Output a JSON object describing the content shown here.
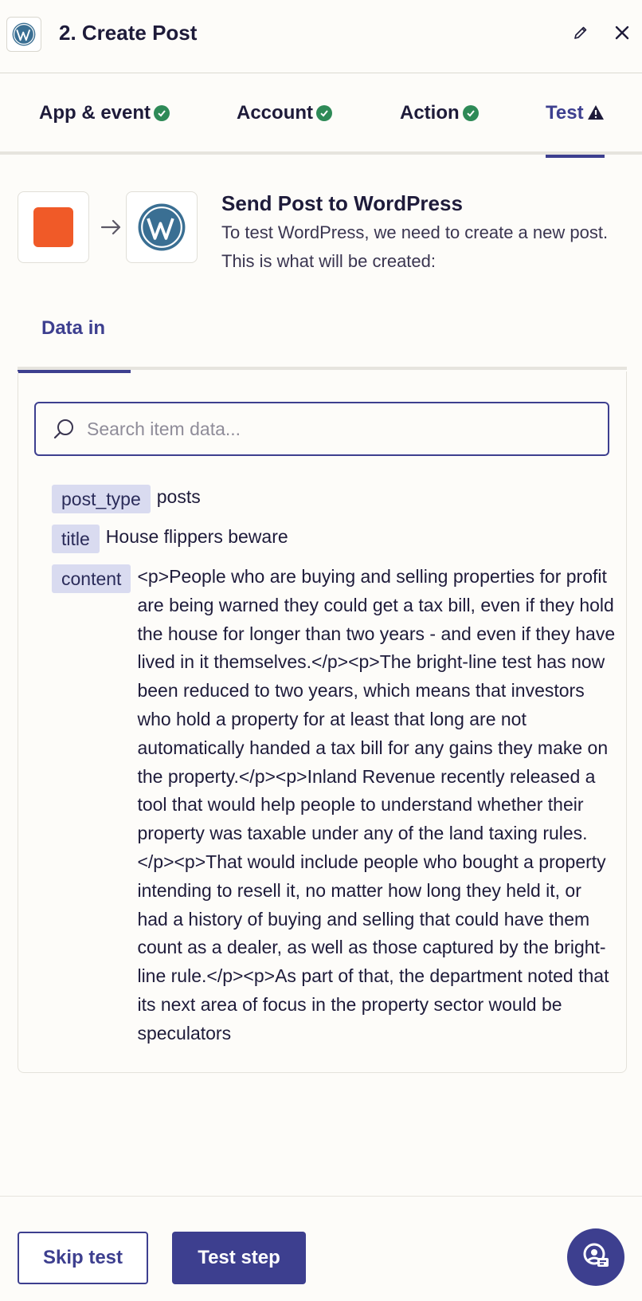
{
  "header": {
    "title": "2. Create Post"
  },
  "tabs": [
    {
      "label": "App & event",
      "status": "complete"
    },
    {
      "label": "Account",
      "status": "complete"
    },
    {
      "label": "Action",
      "status": "complete"
    },
    {
      "label": "Test",
      "status": "warning"
    }
  ],
  "summary": {
    "title": "Send Post to WordPress",
    "description": "To test WordPress, we need to create a new post. This is what will be created:"
  },
  "data_tab": {
    "label": "Data in"
  },
  "search": {
    "placeholder": "Search item data...",
    "value": ""
  },
  "fields": [
    {
      "key": "post_type",
      "value": "posts"
    },
    {
      "key": "title",
      "value": "House flippers beware"
    },
    {
      "key": "content",
      "value": "<p>People who are buying and selling properties for profit are being warned they could get a tax bill, even if they hold the house for longer than two years - and even if they have lived in it themselves.</p><p>The bright-line test has now been reduced to two years, which means that investors who hold a property for at least that long are not automatically handed a tax bill for any gains they make on the property.</p><p>Inland Revenue recently released a tool that would help people to understand whether their property was taxable under any of the land taxing rules.</p><p>That would include people who bought a property intending to resell it, no matter how long they held it, or had a history of buying and selling that could have them count as a dealer, as well as those captured by the bright-line rule.</p><p>As part of that, the department noted that its next area of focus in the property sector would be speculators"
    }
  ],
  "footer": {
    "skip_label": "Skip test",
    "test_label": "Test step"
  },
  "colors": {
    "accent": "#3d3f8f",
    "success": "#2e8a57",
    "source_app": "#f05a28",
    "wordpress": "#3a6f93"
  }
}
